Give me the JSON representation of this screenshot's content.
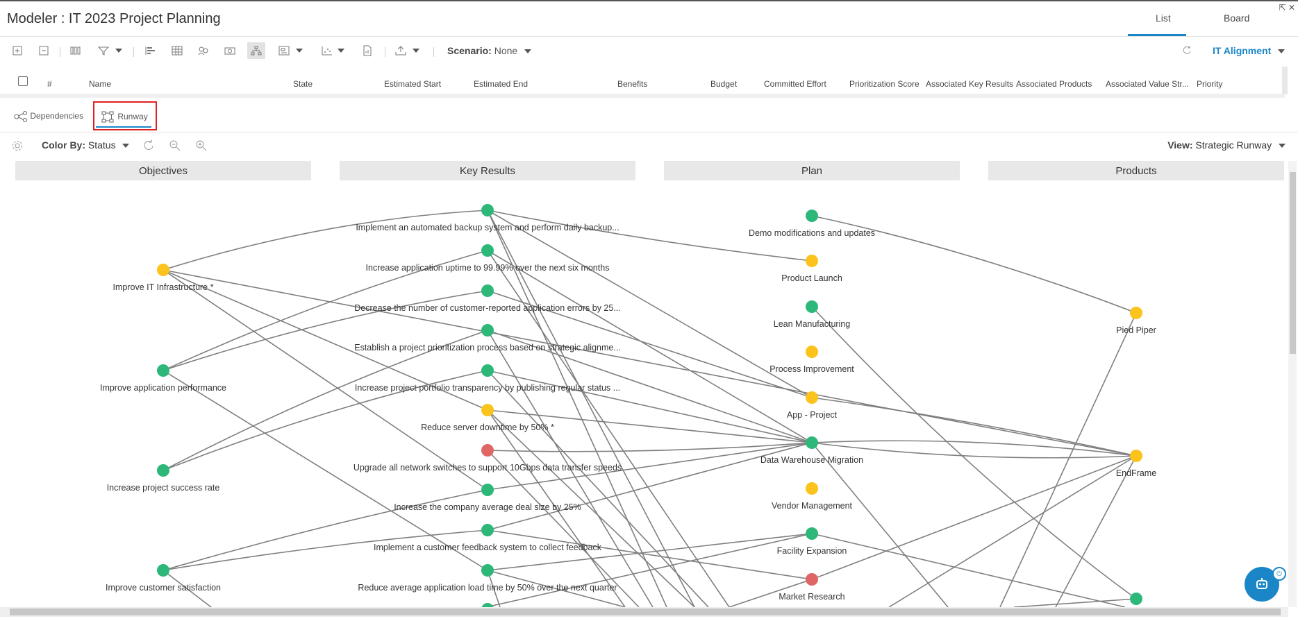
{
  "window": {
    "title": "Modeler : IT 2023 Project Planning",
    "view_tabs": [
      "List",
      "Board"
    ],
    "active_view_tab": "List",
    "restore_icon": "⇱",
    "close_icon": "✕"
  },
  "toolbar": {
    "icons": [
      "expand-all-icon",
      "collapse-all-icon",
      "columns-icon",
      "filter-icon",
      "gantt-icon",
      "grid-icon",
      "people-icon",
      "money-icon",
      "hierarchy-icon",
      "layout-icon",
      "scatter-icon",
      "report-icon",
      "export-icon"
    ],
    "scenario_label": "Scenario:",
    "scenario_value": "None",
    "alignment_label": "IT Alignment"
  },
  "table_header": {
    "columns": [
      "#",
      "Name",
      "State",
      "Estimated Start",
      "Estimated End",
      "Benefits",
      "Budget",
      "Committed Effort",
      "Prioritization Score",
      "Associated Key Results",
      "Associated Products",
      "Associated Value Str...",
      "Priority"
    ]
  },
  "subtabs": {
    "dependencies": "Dependencies",
    "runway": "Runway",
    "active": "Runway"
  },
  "graph_toolbar": {
    "color_by_label": "Color By:",
    "color_by_value": "Status",
    "view_label": "View:",
    "view_value": "Strategic Runway"
  },
  "colors": {
    "green": "#2db87a",
    "yellow": "#fbc31b",
    "red": "#e06666",
    "link": "#7f7f7f",
    "accent": "#1a86c8"
  },
  "graph": {
    "columns": [
      "Objectives",
      "Key Results",
      "Plan",
      "Products"
    ],
    "objectives": [
      {
        "label": "Improve IT Infrastructure *",
        "status": "yellow"
      },
      {
        "label": "Improve application performance",
        "status": "green"
      },
      {
        "label": "Increase project success rate",
        "status": "green"
      },
      {
        "label": "Improve customer satisfaction",
        "status": "green"
      }
    ],
    "key_results": [
      {
        "label": "Implement an automated backup system and perform daily backup...",
        "status": "green"
      },
      {
        "label": "Increase application uptime to 99.99% over the next six months",
        "status": "green"
      },
      {
        "label": "Decrease the number of customer-reported application errors by 25...",
        "status": "green"
      },
      {
        "label": "Establish a project prioritization process based on strategic alignme...",
        "status": "green"
      },
      {
        "label": "Increase project portfolio transparency by publishing regular status ...",
        "status": "green"
      },
      {
        "label": "Reduce server downtime by 50% *",
        "status": "yellow"
      },
      {
        "label": "Upgrade all network switches to support 10Gbps data transfer speeds",
        "status": "red"
      },
      {
        "label": "Increase the company average deal size by 25%",
        "status": "green"
      },
      {
        "label": "Implement a customer feedback system to collect feedback",
        "status": "green"
      },
      {
        "label": "Reduce average application load time by 50% over the next quarter",
        "status": "green"
      }
    ],
    "plan": [
      {
        "label": "Demo modifications and updates",
        "status": "green"
      },
      {
        "label": "Product Launch",
        "status": "yellow"
      },
      {
        "label": "Lean Manufacturing",
        "status": "green"
      },
      {
        "label": "Process Improvement",
        "status": "yellow"
      },
      {
        "label": "App - Project",
        "status": "yellow"
      },
      {
        "label": "Data Warehouse Migration",
        "status": "green"
      },
      {
        "label": "Vendor Management",
        "status": "yellow"
      },
      {
        "label": "Facility Expansion",
        "status": "green"
      },
      {
        "label": "Market Research",
        "status": "red"
      }
    ],
    "products": [
      {
        "label": "Pied Piper",
        "status": "yellow"
      },
      {
        "label": "EndFrame",
        "status": "yellow"
      },
      {
        "label": "",
        "status": "green"
      }
    ]
  }
}
